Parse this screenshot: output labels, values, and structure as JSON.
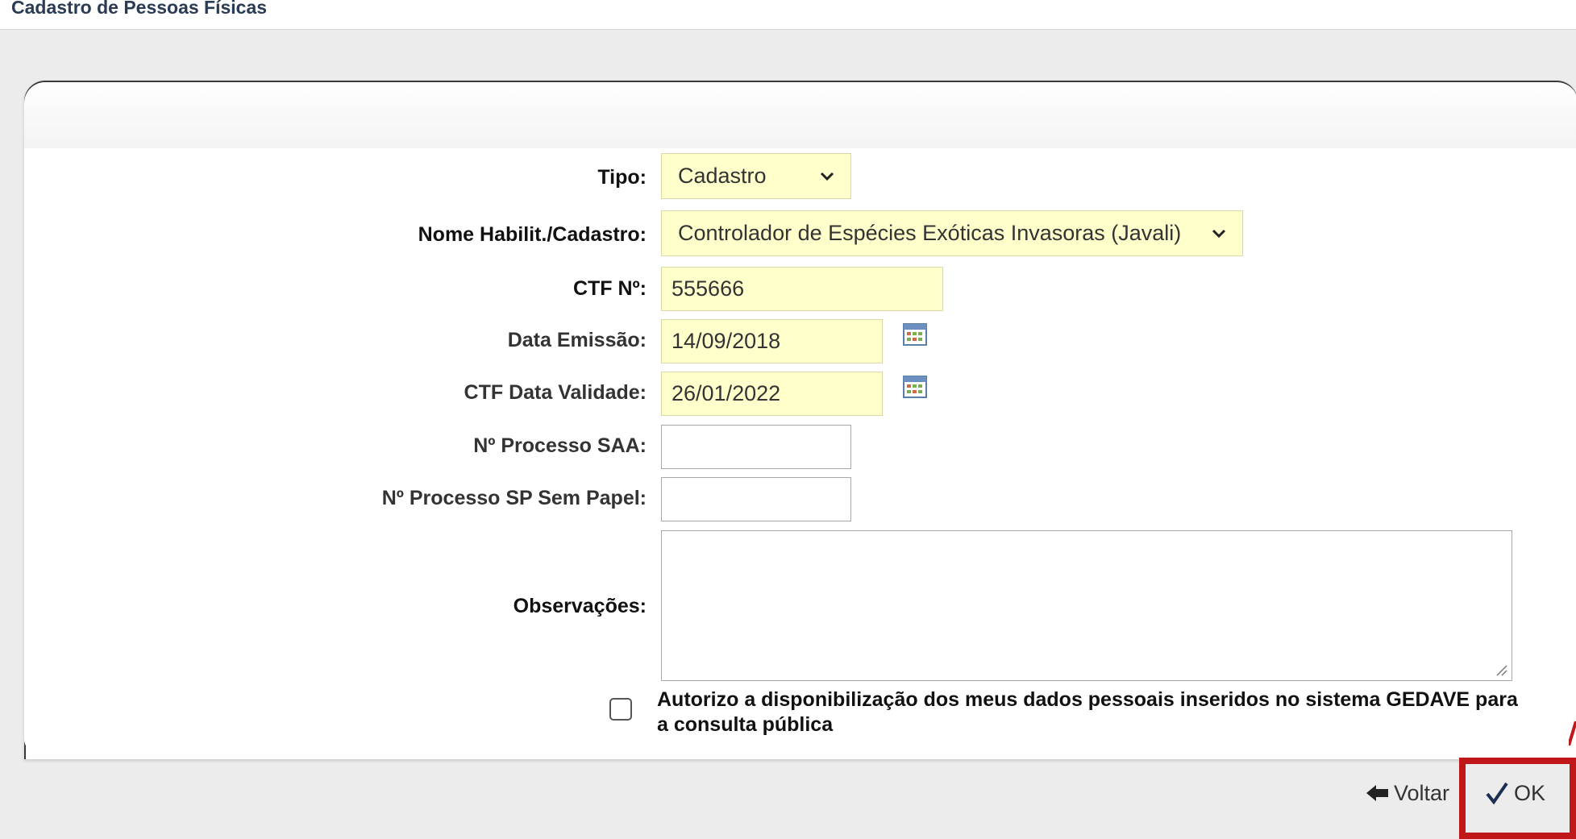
{
  "page": {
    "title": "Cadastro de Pessoas Físicas"
  },
  "form": {
    "tipo": {
      "label": "Tipo:",
      "value": "Cadastro"
    },
    "nome_habilit": {
      "label": "Nome Habilit./Cadastro:",
      "value": "Controlador de Espécies Exóticas Invasoras (Javali)"
    },
    "ctf_numero": {
      "label": "CTF Nº:",
      "value": "555666"
    },
    "data_emissao": {
      "label": "Data Emissão:",
      "value": "14/09/2018"
    },
    "ctf_data_validade": {
      "label": "CTF Data Validade:",
      "value": "26/01/2022"
    },
    "processo_saa": {
      "label": "Nº Processo SAA:",
      "value": ""
    },
    "processo_sp": {
      "label": "Nº Processo SP Sem Papel:",
      "value": ""
    },
    "observacoes": {
      "label": "Observações:",
      "value": ""
    },
    "consent": {
      "text": "Autorizo a disponibilização dos meus dados pessoais inseridos no sistema GEDAVE para a consulta pública",
      "checked": false
    }
  },
  "actions": {
    "voltar_label": "Voltar",
    "ok_label": "OK"
  },
  "icons": {
    "calendar": "calendar-icon",
    "back": "back-arrow-icon",
    "ok": "checkmark-icon",
    "dropdown": "chevron-down-icon"
  },
  "colors": {
    "field_bg": "#ffffcc",
    "title": "#2a3b55",
    "highlight": "#c01818"
  }
}
